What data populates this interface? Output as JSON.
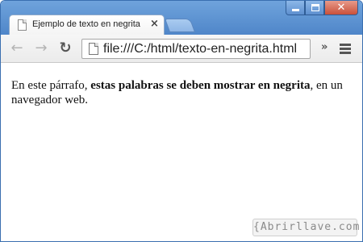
{
  "tab": {
    "title": "Ejemplo de texto en negrita",
    "close_glyph": "×"
  },
  "window_controls": {
    "close_glyph": "✕"
  },
  "toolbar": {
    "back_glyph": "←",
    "forward_glyph": "→",
    "reload_glyph": "↻",
    "url": "file:///C:/html/texto-en-negrita.html",
    "overflow_glyph": "»"
  },
  "content": {
    "text_before": "En este párrafo, ",
    "bold_text": "estas palabras se deben mostrar en negrita",
    "text_after": ", en un navegador web."
  },
  "watermark": {
    "text": "{Abrirllave.com"
  },
  "icons": {
    "tab": "page-icon",
    "omnibox": "page-icon",
    "menu": "hamburger-menu-icon"
  },
  "colors": {
    "titlebar": "#5b8fd0",
    "toolbar": "#f1f1f1",
    "page_background": "#ffffff"
  }
}
